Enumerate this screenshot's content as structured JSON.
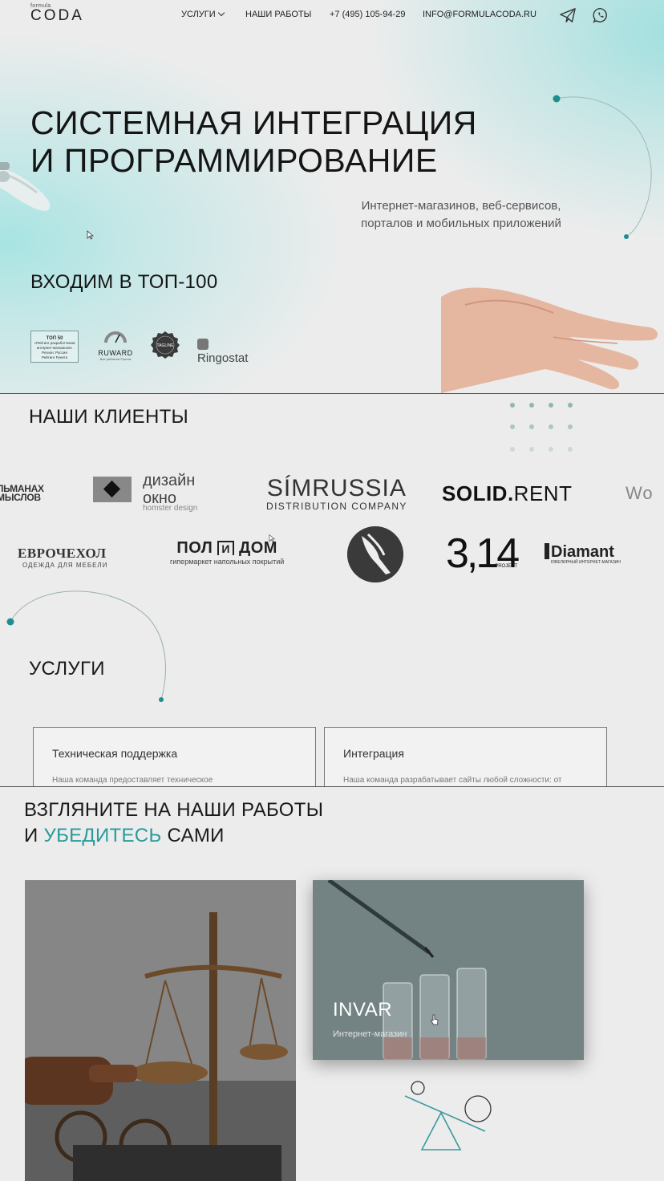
{
  "header": {
    "logo_small": "formula",
    "logo_big": "CODA",
    "nav": {
      "services": "УСЛУГИ",
      "works": "НАШИ РАБОТЫ",
      "phone": "+7 (495) 105-94-29",
      "email": "INFO@FORMULACODA.RU"
    },
    "icons": [
      "telegram-icon",
      "whatsapp-icon",
      "chevron-down-icon"
    ]
  },
  "hero": {
    "title_line1": "СИСТЕМНАЯ ИНТЕГРАЦИЯ",
    "title_line2": "И ПРОГРАММИРОВАНИЕ",
    "subtitle_line1": "Интернет-магазинов, веб-сервисов,",
    "subtitle_line2": "порталов и мобильных приложений",
    "top_text": "ВХОДИМ В ТОП-100",
    "badges": {
      "top50_title": "ТОП 50",
      "top50_text": "«Рейтинг разработчиков интернет-магазинов»",
      "top50_region": "Регион: Россия",
      "top50_source": "Рейтинг Рунета",
      "ruward": "RUWARD",
      "ruward_sub": "Все рейтинги Рунета",
      "tagline": "TAGLINE",
      "ringostat": "Ringostat"
    }
  },
  "clients": {
    "title": "НАШИ КЛИЕНТЫ",
    "row1": {
      "almanach_1": "ЛЬМАНАХ",
      "almanach_2": "МЫСЛОВ",
      "okno_1": "дизайн",
      "okno_2": "окно",
      "okno_3": "homster design",
      "simrussia_1": "SÍMRUSSIA",
      "simrussia_2": "DISTRIBUTION COMPANY",
      "solid_bold": "SOLID.",
      "solid_rest": "RENT",
      "wo": "Wo"
    },
    "row2": {
      "evro_1": "ЕВРОЧЕХОЛ",
      "evro_2": "ОДЕЖДА ДЛЯ МЕБЕЛИ",
      "poldom_1": "ПОЛ",
      "poldom_mid": "И",
      "poldom_2": "ДОМ",
      "poldom_3": "гипермаркет напольных покрытий",
      "p314": "3,14",
      "p314_sub": "PROJECT",
      "diamant": "Diamant",
      "diamant_sub": "ЮВЕЛИРНЫЙ ИНТЕРНЕТ-МАГАЗИН"
    }
  },
  "services": {
    "title": "УСЛУГИ",
    "cards": [
      {
        "title": "Техническая поддержка",
        "text": "Наша команда предоставляет техническое"
      },
      {
        "title": "Интеграция",
        "text": "Наша команда разрабатывает сайты любой сложности: от"
      }
    ]
  },
  "works": {
    "title_line1": "ВЗГЛЯНИТЕ НА НАШИ РАБОТЫ",
    "title_line2_pre": "И ",
    "title_line2_accent": "УБЕДИТЕСЬ",
    "title_line2_post": " САМИ",
    "items": [
      {
        "title": "",
        "subtitle": ""
      },
      {
        "title": "INVAR",
        "subtitle": "Интернет-магазин"
      }
    ]
  },
  "colors": {
    "accent": "#2a9a9b",
    "hero_teal": "#a8e4e3",
    "background": "#ececec"
  }
}
